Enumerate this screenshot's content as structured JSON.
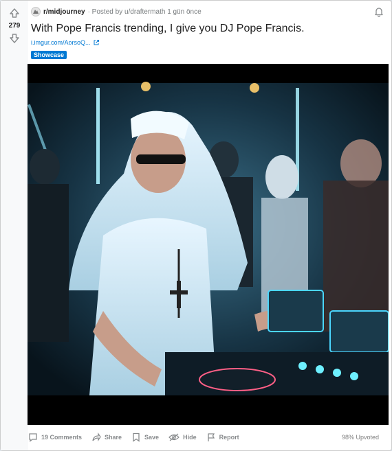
{
  "post": {
    "score": "279",
    "subreddit": "r/midjourney",
    "posted_by": "· Posted by u/draftermath 1 gün önce",
    "title": "With Pope Francis trending, I give you DJ Pope Francis.",
    "link_text": "i.imgur.com/AorsoQ...",
    "flair": "Showcase",
    "image_alt": "AI-generated image of the Pope as a DJ at a club turntable"
  },
  "actions": {
    "comments": "19 Comments",
    "share": "Share",
    "save": "Save",
    "hide": "Hide",
    "report": "Report",
    "upvoted": "98% Upvoted"
  },
  "colors": {
    "accent": "#0079d3",
    "muted": "#878a8c",
    "page_bg": "#dae0e6"
  },
  "icons": [
    "upvote-arrow-icon",
    "downvote-arrow-icon",
    "subreddit-icon",
    "bell-icon",
    "external-link-icon",
    "comment-icon",
    "share-icon",
    "save-icon",
    "hide-icon",
    "report-icon"
  ]
}
